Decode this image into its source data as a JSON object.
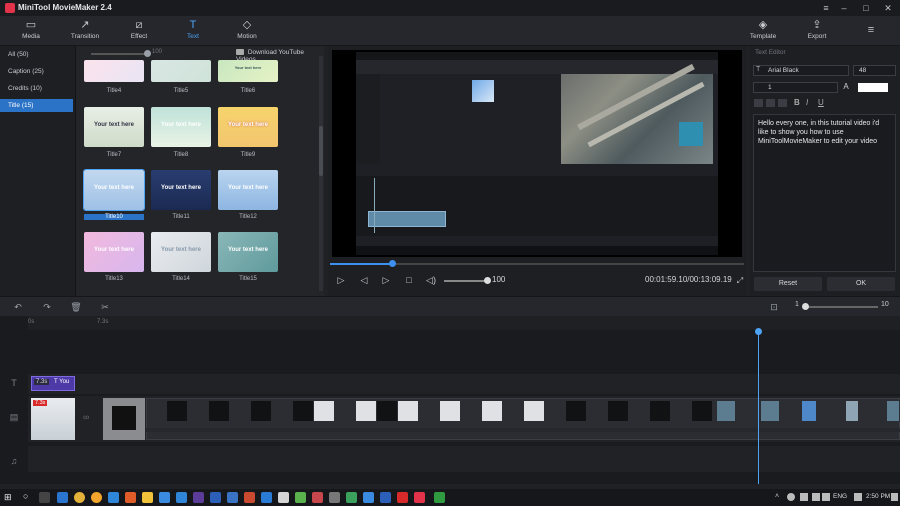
{
  "app": {
    "title": "MiniTool MovieMaker 2.4"
  },
  "window": {
    "minimize": "–",
    "maximize": "□",
    "close": "✕",
    "menu": "≡"
  },
  "toolbar": {
    "items": [
      {
        "label": "Media",
        "icon": "folder-icon",
        "glyph": "▭"
      },
      {
        "label": "Transition",
        "icon": "transition-icon",
        "glyph": "↗"
      },
      {
        "label": "Effect",
        "icon": "effect-icon",
        "glyph": "⧄"
      },
      {
        "label": "Text",
        "icon": "text-icon",
        "glyph": "T"
      },
      {
        "label": "Motion",
        "icon": "motion-icon",
        "glyph": "◇"
      }
    ],
    "right": [
      {
        "label": "Template",
        "icon": "template-icon",
        "glyph": "◈"
      },
      {
        "label": "Export",
        "icon": "export-icon",
        "glyph": "⇪"
      }
    ],
    "active": "Text"
  },
  "categories": [
    "All (50)",
    "Caption (25)",
    "Credits (10)",
    "Title (15)"
  ],
  "selected_category": "Title (15)",
  "library": {
    "zoom_value": "100",
    "download_link": "Download YouTube Videos",
    "thumbs": [
      {
        "label": "Title4",
        "text": ""
      },
      {
        "label": "Title5",
        "text": ""
      },
      {
        "label": "Title6",
        "text": "Your text here"
      },
      {
        "label": "Title7",
        "text": "Your text here"
      },
      {
        "label": "Title8",
        "text": "Your text here"
      },
      {
        "label": "Title9",
        "text": "Your text here"
      },
      {
        "label": "Title10",
        "text": "Your text here"
      },
      {
        "label": "Title11",
        "text": "Your text here"
      },
      {
        "label": "Title12",
        "text": "Your text here"
      },
      {
        "label": "Title13",
        "text": "Your text here"
      },
      {
        "label": "Title14",
        "text": "Your text here"
      },
      {
        "label": "Title15",
        "text": "Your text here"
      }
    ],
    "selected": "Title10"
  },
  "player": {
    "volume": "100",
    "timecode": "00:01:59.10/00:13:09.19",
    "progress": 0.15
  },
  "editor": {
    "title": "Text Editor",
    "font": "Arial Black",
    "size": "48",
    "line": "1",
    "text": "Hello every one, in this tutorial video i'd like to show you how to use MiniToolMovieMaker to edit your video",
    "reset": "Reset",
    "ok": "OK"
  },
  "timeline": {
    "ruler": [
      "0s",
      "7.3s"
    ],
    "zoom_min": "1",
    "zoom_max": "10",
    "text_clip_duration": "7.3s",
    "text_clip_label": "T You",
    "video_clip_badge": "7.3s",
    "tracks": [
      "T",
      "▤",
      "♫"
    ]
  },
  "taskbar": {
    "lang": "ENG",
    "time": "2:50 PM"
  },
  "colors": {
    "accent": "#4ea3f5",
    "selection": "#2b73c6",
    "brand": "#e3334a"
  }
}
